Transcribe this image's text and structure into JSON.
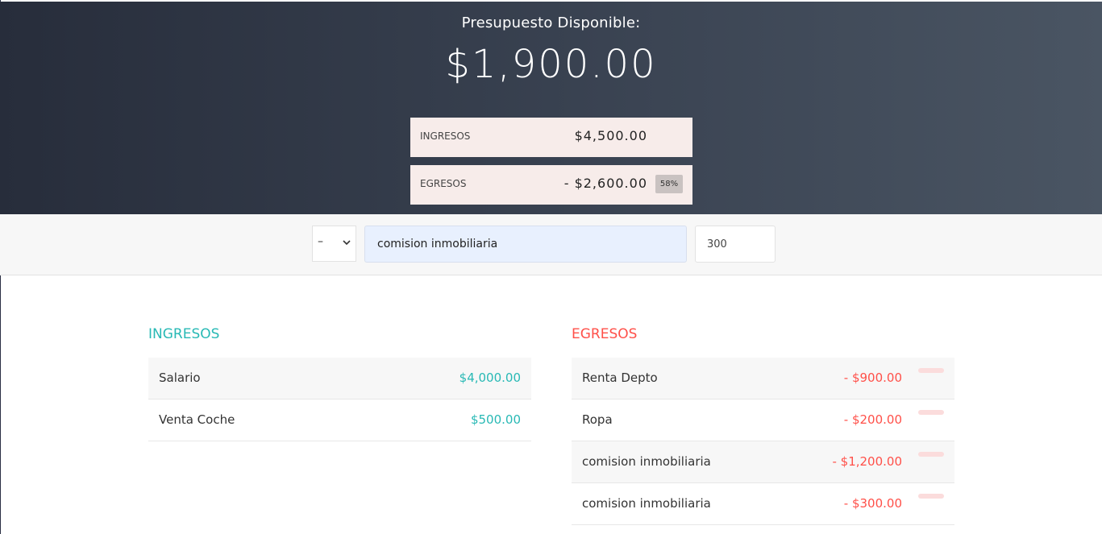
{
  "header": {
    "title": "Presupuesto Disponible:",
    "available": "$1,900.00",
    "income_label": "INGRESOS",
    "income_value": "$4,500.00",
    "expense_label": "EGRESOS",
    "expense_value": "- $2,600.00",
    "expense_percent": "58%"
  },
  "form": {
    "type_value": "–",
    "description_value": "comision inmobiliaria",
    "amount_value": "300"
  },
  "income": {
    "title": "INGRESOS",
    "items": [
      {
        "description": "Salario",
        "value": "$4,000.00"
      },
      {
        "description": "Venta Coche",
        "value": "$500.00"
      }
    ]
  },
  "expenses": {
    "title": "EGRESOS",
    "items": [
      {
        "description": "Renta Depto",
        "value": "- $900.00"
      },
      {
        "description": "Ropa",
        "value": "- $200.00"
      },
      {
        "description": "comision inmobiliaria",
        "value": "- $1,200.00"
      },
      {
        "description": "comision inmobiliaria",
        "value": "- $300.00"
      }
    ]
  },
  "colors": {
    "income": "#28b9b5",
    "expense": "#ff5049",
    "summary_bg": "#f7ecea"
  },
  "icons": {
    "select_arrow": "chevron-down-icon",
    "delete": "delete-icon"
  }
}
